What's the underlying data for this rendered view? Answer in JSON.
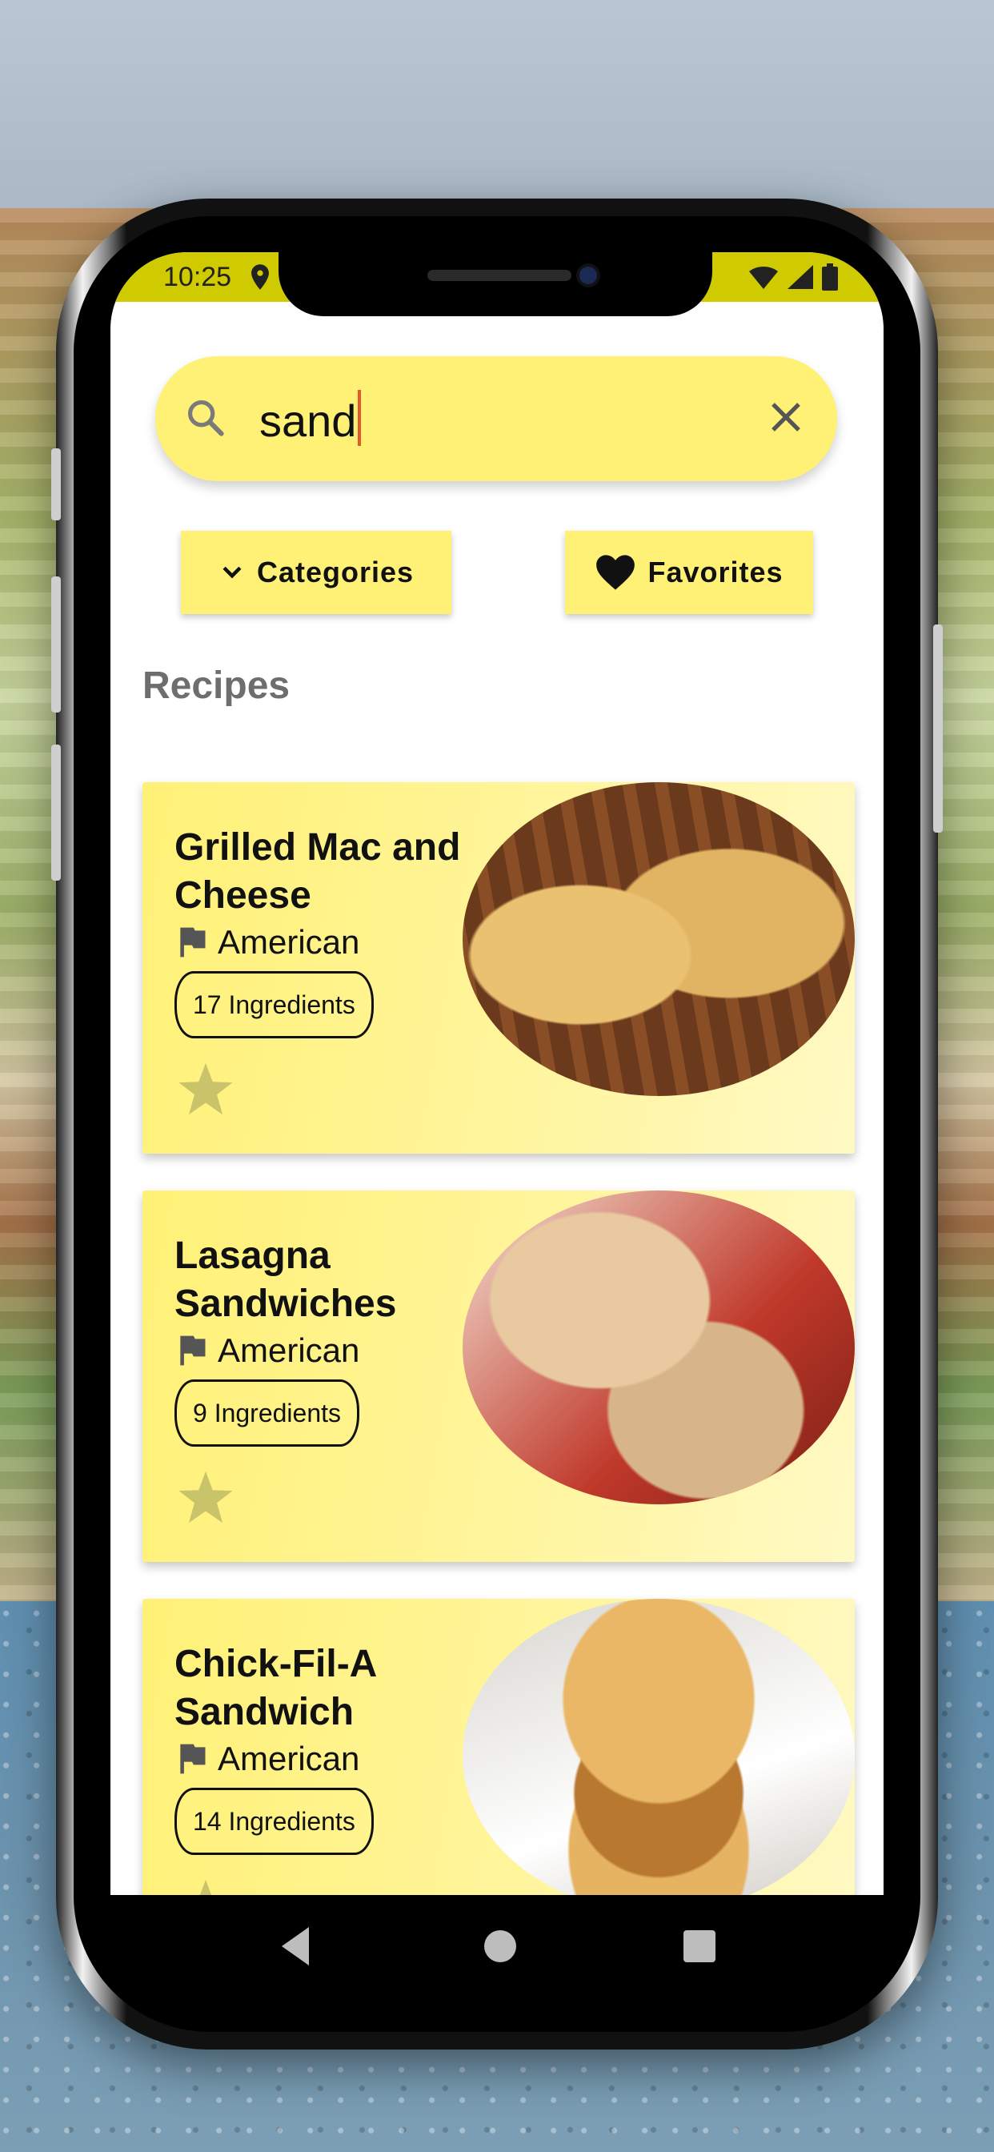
{
  "status_bar": {
    "time": "10:25",
    "color": "#cfcb00",
    "icons": [
      "location-icon",
      "wifi-icon",
      "signal-icon",
      "battery-icon"
    ]
  },
  "search": {
    "query": "sand",
    "icon": "search-icon",
    "clear_icon": "close-icon"
  },
  "buttons": {
    "categories": {
      "label": "Categories",
      "icon": "chevron-down-icon"
    },
    "favorites": {
      "label": "Favorites",
      "icon": "heart-icon"
    }
  },
  "section_title": "Recipes",
  "recipes": [
    {
      "title": "Grilled Mac and Cheese",
      "cuisine": "American",
      "ingredients": "17 Ingredients",
      "favorited": false
    },
    {
      "title": "Lasagna Sandwiches",
      "cuisine": "American",
      "ingredients": "9 Ingredients",
      "favorited": false
    },
    {
      "title": "Chick-Fil-A Sandwich",
      "cuisine": "American",
      "ingredients": "14 Ingredients",
      "favorited": false
    }
  ],
  "nav": [
    "back-icon",
    "home-icon",
    "recents-icon"
  ],
  "colors": {
    "accent": "#fff176",
    "card_gradient_end": "#fff9c4",
    "section_title": "#6e6e6e",
    "caret": "#e4572e"
  }
}
